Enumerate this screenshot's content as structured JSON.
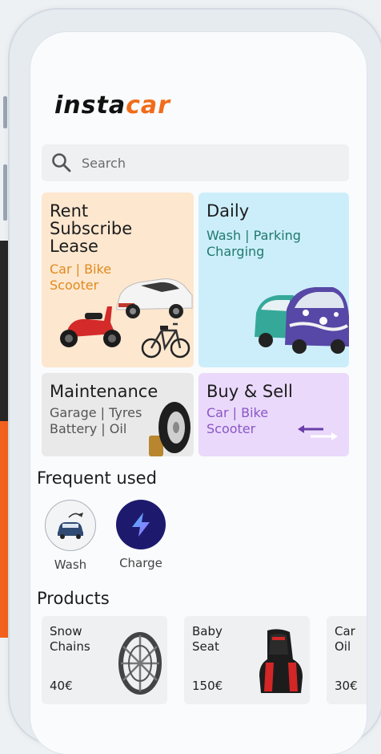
{
  "brand": {
    "part1": "insta",
    "part2": "car",
    "colors": {
      "dark": "#111111",
      "accent": "#f06c1a"
    }
  },
  "search": {
    "placeholder": "Search",
    "icon": "search-icon"
  },
  "services": [
    {
      "title_lines": [
        "Rent",
        "Subscribe",
        "Lease"
      ],
      "sub_lines": [
        "Car | Bike",
        "Scooter"
      ],
      "bg": "#fde7cf",
      "sub_color": "#e08a1e"
    },
    {
      "title_lines": [
        "Daily"
      ],
      "sub_lines": [
        "Wash | Parking",
        "Charging"
      ],
      "bg": "#cceefb",
      "sub_color": "#1f7a6b"
    },
    {
      "title_lines": [
        "Maintenance"
      ],
      "sub_lines": [
        "Garage | Tyres",
        "Battery | Oil"
      ],
      "bg": "#e9e9e9",
      "sub_color": "#555555"
    },
    {
      "title_lines": [
        "Buy & Sell"
      ],
      "sub_lines": [
        "Car | Bike",
        "Scooter"
      ],
      "bg": "#ead9fb",
      "sub_color": "#8a56c6"
    }
  ],
  "frequent": {
    "title": "Frequent used",
    "items": [
      {
        "label": "Wash",
        "icon": "car-wash-icon"
      },
      {
        "label": "Charge",
        "icon": "charge-bolt-icon"
      }
    ]
  },
  "products": {
    "title": "Products",
    "items": [
      {
        "name_lines": [
          "Snow",
          "Chains"
        ],
        "price": "40€",
        "icon": "snow-chains-icon"
      },
      {
        "name_lines": [
          "Baby",
          "Seat"
        ],
        "price": "150€",
        "icon": "baby-seat-icon"
      },
      {
        "name_lines": [
          "Car",
          "Oil"
        ],
        "price": "30€",
        "icon": "car-oil-icon"
      }
    ]
  }
}
